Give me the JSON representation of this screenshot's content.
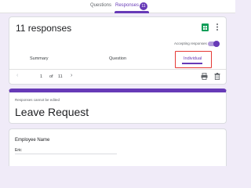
{
  "tabs": {
    "questions": "Questions",
    "responses": "Responses",
    "responses_count": "11"
  },
  "summary_card": {
    "title": "11 responses",
    "accepting_label": "Accepting responses",
    "accepting_enabled": true,
    "view_tabs": [
      "Summary",
      "Question",
      "Individual"
    ],
    "active_view": "Individual",
    "pager": {
      "prev": "‹",
      "current": "1",
      "of": "of",
      "total": "11",
      "next": "›"
    },
    "icons": [
      "sheets-icon",
      "more-vert-icon",
      "print-icon",
      "delete-icon"
    ]
  },
  "form": {
    "notice": "Responses cannot be edited",
    "title": "Leave Request"
  },
  "question": {
    "label": "Employee Name",
    "answer": "Eric"
  },
  "colors": {
    "accent": "#673ab7",
    "background": "#f0ebf8",
    "highlight": "#e53935",
    "sheets_green": "#0f9d58"
  }
}
